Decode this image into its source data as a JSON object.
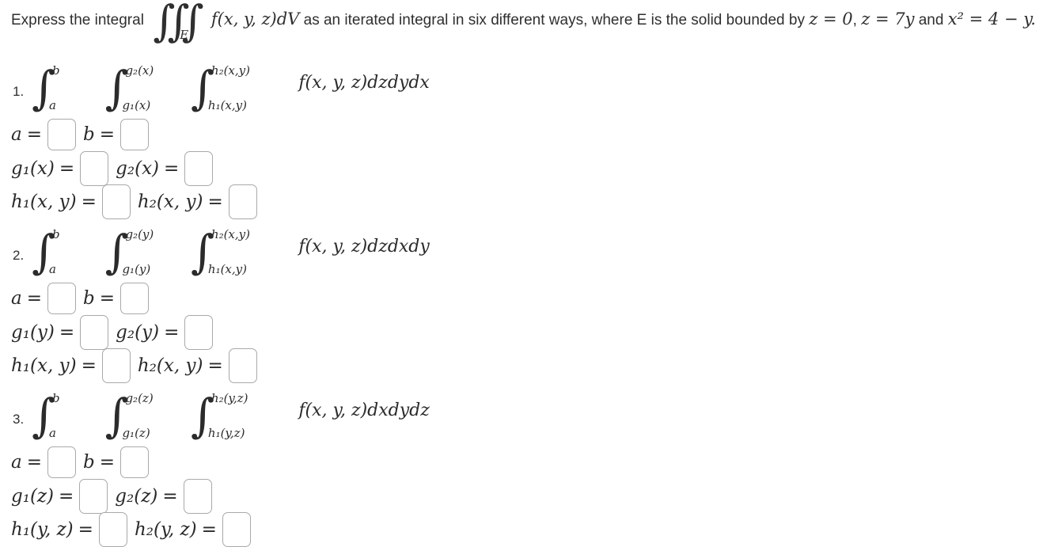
{
  "prompt": {
    "lead": "Express the integral",
    "integral_symbol": "∭",
    "integral_subscript": "E",
    "integrand": "f(x, y, z)dV",
    "middle": "as an iterated integral in six different ways, where E is the solid bounded by",
    "condition_1": "z = 0",
    "condition_separator": ", ",
    "condition_2": "z = 7y",
    "tail": "and",
    "condition_3": "x² = 4 − y."
  },
  "problems": [
    {
      "number": "1.",
      "integral": {
        "outer_upper": "b",
        "outer_lower": "a",
        "middle_upper": "g₂(x)",
        "middle_lower": "g₁(x)",
        "inner_upper": "h₂(x,y)",
        "inner_lower": "h₁(x,y)",
        "integrand": "f(x, y, z)dzdydx"
      },
      "fields": [
        {
          "label_a": "a",
          "label_b": "b",
          "value_a": "",
          "value_b": ""
        },
        {
          "label_a": "g₁(x)",
          "label_b": "g₂(x)",
          "value_a": "",
          "value_b": ""
        },
        {
          "label_a": "h₁(x, y)",
          "label_b": "h₂(x, y)",
          "value_a": "",
          "value_b": ""
        }
      ]
    },
    {
      "number": "2.",
      "integral": {
        "outer_upper": "b",
        "outer_lower": "a",
        "middle_upper": "g₂(y)",
        "middle_lower": "g₁(y)",
        "inner_upper": "h₂(x,y)",
        "inner_lower": "h₁(x,y)",
        "integrand": "f(x, y, z)dzdxdy"
      },
      "fields": [
        {
          "label_a": "a",
          "label_b": "b",
          "value_a": "",
          "value_b": ""
        },
        {
          "label_a": "g₁(y)",
          "label_b": "g₂(y)",
          "value_a": "",
          "value_b": ""
        },
        {
          "label_a": "h₁(x, y)",
          "label_b": "h₂(x, y)",
          "value_a": "",
          "value_b": ""
        }
      ]
    },
    {
      "number": "3.",
      "integral": {
        "outer_upper": "b",
        "outer_lower": "a",
        "middle_upper": "g₂(z)",
        "middle_lower": "g₁(z)",
        "inner_upper": "h₂(y,z)",
        "inner_lower": "h₁(y,z)",
        "integrand": "f(x, y, z)dxdydz"
      },
      "fields": [
        {
          "label_a": "a",
          "label_b": "b",
          "value_a": "",
          "value_b": ""
        },
        {
          "label_a": "g₁(z)",
          "label_b": "g₂(z)",
          "value_a": "",
          "value_b": ""
        },
        {
          "label_a": "h₁(y, z)",
          "label_b": "h₂(y, z)",
          "value_a": "",
          "value_b": ""
        }
      ]
    }
  ],
  "colors": {
    "text": "#2f2f2f",
    "input_border": "#a9a9a9",
    "background": "#ffffff"
  }
}
